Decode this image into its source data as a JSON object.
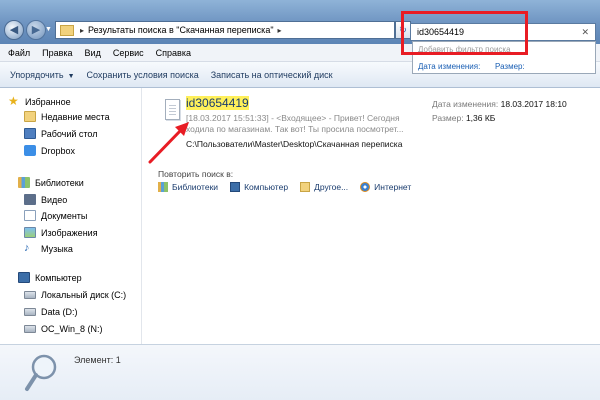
{
  "address_bar": {
    "crumb": "Результаты поиска в \"Скачанная переписка\"",
    "separator": "▸",
    "end_arrow": "▸"
  },
  "search": {
    "value": "id30654419",
    "clear": "✕",
    "suggestion_hint": "Добавить фильтр поиска",
    "filter_modified": "Дата изменения:",
    "filter_size": "Размер:"
  },
  "menu": [
    "Файл",
    "Правка",
    "Вид",
    "Сервис",
    "Справка"
  ],
  "toolbar": {
    "organize": "Упорядочить",
    "organize_arrow": "▼",
    "save_search": "Сохранить условия поиска",
    "burn": "Записать на оптический диск"
  },
  "sidebar": {
    "favorites": "Избранное",
    "recent": "Недавние места",
    "desktop": "Рабочий стол",
    "dropbox": "Dropbox",
    "libraries": "Библиотеки",
    "video": "Видео",
    "documents": "Документы",
    "images": "Изображения",
    "music": "Музыка",
    "computer": "Компьютер",
    "disk_c": "Локальный диск (C:)",
    "disk_d": "Data (D:)",
    "disk_n": "OC_Win_8 (N:)"
  },
  "result": {
    "name": "id30654419",
    "snippet": "[18.03.2017 15:51:33] - <Входящее> - Привет! Сегодня ходила по магазинам. Так вот! Ты просила посмотрет...",
    "path": "C:\\Пользователи\\Master\\Desktop\\Скачанная переписка",
    "modified_label": "Дата изменения:",
    "modified_value": "18.03.2017 18:10",
    "size_label": "Размер:",
    "size_value": "1,36 КБ"
  },
  "search_again": {
    "label": "Повторить поиск в:",
    "libraries": "Библиотеки",
    "computer": "Компьютер",
    "other": "Другое...",
    "internet": "Интернет"
  },
  "status": {
    "items": "Элемент: 1"
  },
  "colors": {
    "highlight_border": "#e81c24",
    "match_highlight": "#fff05a",
    "arrow": "#e81c24"
  }
}
